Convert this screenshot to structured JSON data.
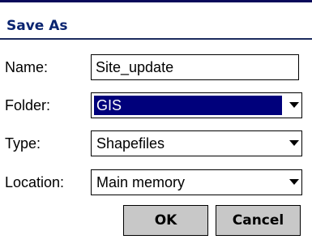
{
  "dialog": {
    "title": "Save As"
  },
  "form": {
    "name": {
      "label": "Name:",
      "value": "Site_update"
    },
    "folder": {
      "label": "Folder:",
      "value": "GIS"
    },
    "type": {
      "label": "Type:",
      "value": "Shapefiles"
    },
    "location": {
      "label": "Location:",
      "value": "Main memory"
    }
  },
  "buttons": {
    "ok_label": "OK",
    "cancel_label": "Cancel"
  },
  "colors": {
    "title_text": "#0a2470",
    "selection_highlight": "#00007b",
    "button_face": "#c8c8c8"
  },
  "icons": {
    "dropdown": "chevron-down-icon"
  }
}
